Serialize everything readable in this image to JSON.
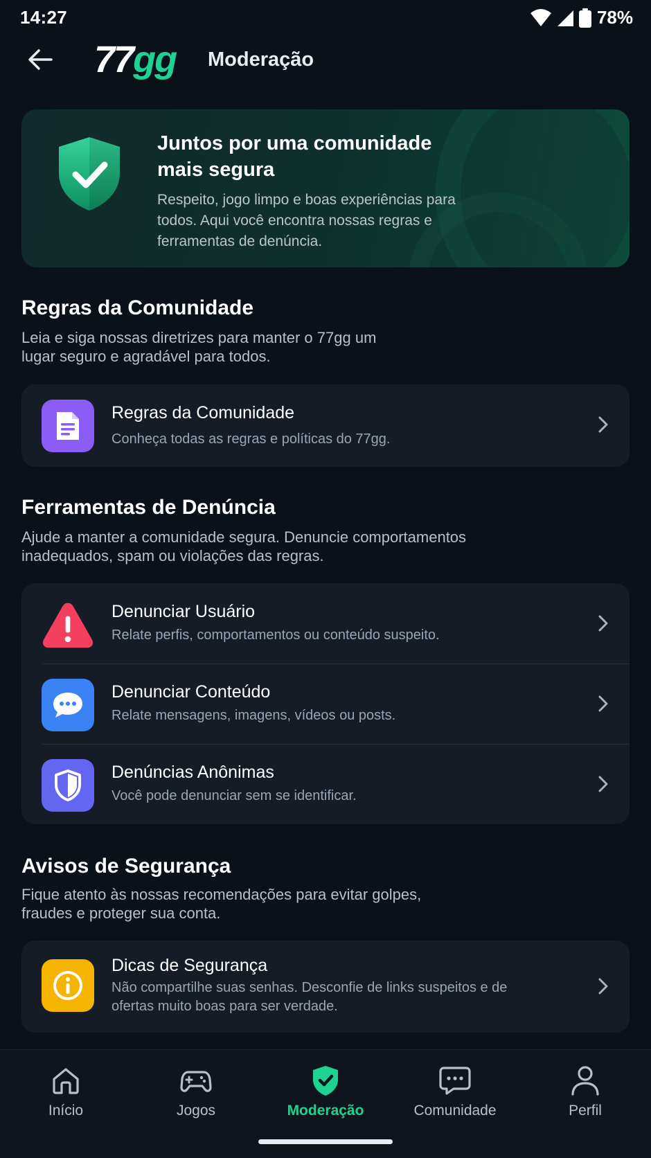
{
  "status": {
    "time": "14:27",
    "battery": "78%"
  },
  "header": {
    "logo_a": "77",
    "logo_b": "gg",
    "title": "Moderação"
  },
  "hero": {
    "title": "Juntos por uma comunidade mais segura",
    "text": "Respeito, jogo limpo e boas experiências para todos. Aqui você encontra nossas regras e ferramentas de denúncia."
  },
  "sections": [
    {
      "title": "Regras da Comunidade",
      "desc": "Leia e siga nossas diretrizes para manter o 77gg um lugar seguro e agradável para todos.",
      "items": [
        {
          "title": "Regras da Comunidade",
          "sub": "Conheça todas as regras e políticas do 77gg.",
          "icon": "document-icon",
          "color": "#8b5cf6"
        }
      ]
    },
    {
      "title": "Ferramentas de Denúncia",
      "desc": "Ajude a manter a comunidade segura. Denuncie comportamentos inadequados, spam ou violações das regras.",
      "items": [
        {
          "title": "Denunciar Usuário",
          "sub": "Relate perfis, comportamentos ou conteúdo suspeito.",
          "icon": "warning-icon",
          "color": "#f43f5e"
        },
        {
          "title": "Denunciar Conteúdo",
          "sub": "Relate mensagens, imagens, vídeos ou posts.",
          "icon": "chat-bubble-icon",
          "color": "#3b82f6"
        },
        {
          "title": "Denúncias Anônimas",
          "sub": "Você pode denunciar sem se identificar.",
          "icon": "shield-icon",
          "color": "#6366f1"
        }
      ]
    },
    {
      "title": "Avisos de Segurança",
      "desc": "Fique atento às nossas recomendações para evitar golpes, fraudes e proteger sua conta.",
      "items": [
        {
          "title": "Dicas de Segurança",
          "sub": "Não compartilhe suas senhas. Desconfie de links suspeitos e de ofertas muito boas para ser verdade.",
          "icon": "info-icon",
          "color": "#f5b400"
        }
      ]
    }
  ],
  "nav": [
    {
      "label": "Início",
      "icon": "home-icon"
    },
    {
      "label": "Jogos",
      "icon": "gamepad-icon"
    },
    {
      "label": "Moderação",
      "icon": "shield-check-icon",
      "active": true
    },
    {
      "label": "Comunidade",
      "icon": "chat-icon"
    },
    {
      "label": "Perfil",
      "icon": "user-icon"
    }
  ],
  "colors": {
    "accent": "#1ed391",
    "background": "#0b1118",
    "card": "#151c25"
  }
}
